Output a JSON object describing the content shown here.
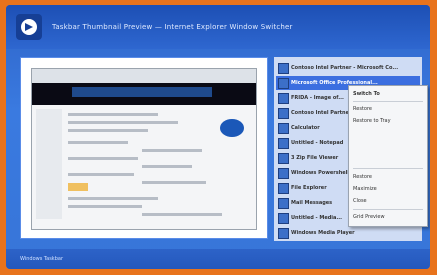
{
  "window": {
    "title": "Taskbar Thumbnail Preview — Internet Explorer Window Switcher",
    "status": "Windows Taskbar"
  },
  "list": {
    "items": [
      {
        "label": "Contoso Intel Partner - Microsoft Co..."
      },
      {
        "label": "Microsoft Office Professional...",
        "selected": true
      },
      {
        "label": "FRIDA - Image of..."
      },
      {
        "label": "Contoso Intel Partner..."
      },
      {
        "label": "Calculator"
      },
      {
        "label": "Untitled - Notepad"
      },
      {
        "label": "3 Zip File Viewer"
      },
      {
        "label": "Windows Powershell"
      },
      {
        "label": "File Explorer"
      },
      {
        "label": "Mail Messages"
      },
      {
        "label": "Untitled - Media..."
      },
      {
        "label": "Windows Media Player"
      }
    ]
  },
  "menu": {
    "items": [
      {
        "label": "Switch To",
        "dim": false
      },
      {
        "label": "Restore",
        "dim": false
      },
      {
        "label": "Restore to Tray",
        "dim": false
      },
      {
        "label": "",
        "dim": true
      },
      {
        "label": "",
        "dim": true
      },
      {
        "label": "",
        "dim": true
      },
      {
        "label": "Restore",
        "dim": false
      },
      {
        "label": "Maximize",
        "dim": false
      },
      {
        "label": "Close",
        "dim": false
      },
      {
        "label": "Grid Preview",
        "dim": false
      }
    ]
  },
  "colors": {
    "frame": "#e8731c",
    "titlebar": "#1d4fb4",
    "selection": "#3b6ee0"
  }
}
